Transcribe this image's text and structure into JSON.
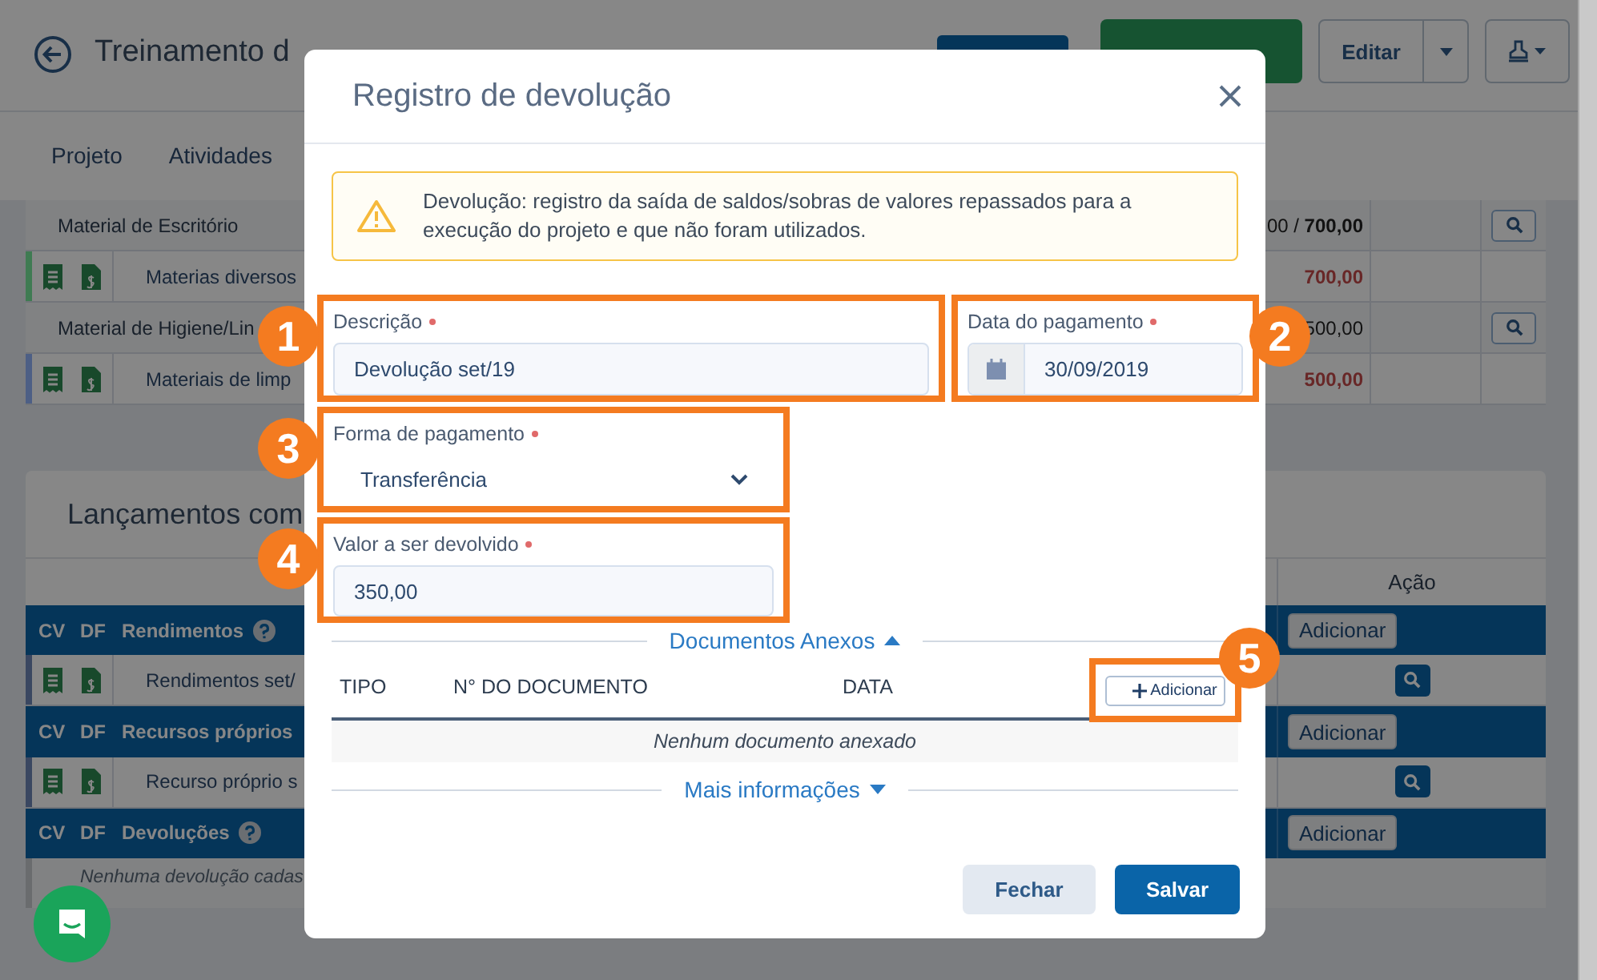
{
  "page": {
    "title": "Treinamento d",
    "edit_button": "Editar"
  },
  "tabs": [
    {
      "label": "Projeto",
      "selected": false
    },
    {
      "label": "Atividades",
      "selected": false
    }
  ],
  "budget_rows": [
    {
      "kind": "group",
      "label": "Material de Escritório",
      "value": "00 / **700,00**"
    },
    {
      "kind": "item",
      "label": "Materias diversos",
      "value": "700,00",
      "color": "#3f7b52"
    },
    {
      "kind": "group",
      "label": "Material de Higiene/Lin",
      "value": "500,00"
    },
    {
      "kind": "item",
      "label": "Materiais de limp",
      "value": "500,00",
      "color": "#4d5f85"
    }
  ],
  "entries": {
    "title": "Lançamentos com",
    "action_header": "Ação",
    "rows": [
      {
        "kind": "category",
        "cv": "CV",
        "df": "DF",
        "label": "Rendimentos",
        "help": true,
        "action": "Adicionar"
      },
      {
        "kind": "entry",
        "label": "Rendimentos set/"
      },
      {
        "kind": "category",
        "cv": "CV",
        "df": "DF",
        "label": "Recursos próprios",
        "help": false,
        "action": "Adicionar"
      },
      {
        "kind": "entry",
        "label": "Recurso próprio s"
      },
      {
        "kind": "category",
        "cv": "CV",
        "df": "DF",
        "label": "Devoluções",
        "help": true,
        "action": "Adicionar"
      },
      {
        "kind": "empty",
        "label": "Nenhuma devolução cadas"
      }
    ]
  },
  "modal": {
    "title": "Registro de devolução",
    "notice": "Devolução: registro da saída de saldos/sobras de valores repassados para a execução do projeto e que não foram utilizados.",
    "fields": [
      {
        "kind": "text",
        "label": "Descrição",
        "required": true,
        "value": "Devolução set/19",
        "callout": "1"
      },
      {
        "kind": "date",
        "label": "Data do pagamento",
        "required": true,
        "value": "30/09/2019",
        "callout": "2"
      },
      {
        "kind": "select",
        "label": "Forma de pagamento",
        "required": true,
        "value": "Transferência",
        "callout": "3"
      },
      {
        "kind": "text",
        "label": "Valor a ser devolvido",
        "required": true,
        "value": "350,00",
        "callout": "4"
      }
    ],
    "attachments": {
      "title": "Documentos Anexos",
      "expanded": true,
      "columns": [
        "TIPO",
        "N° DO DOCUMENTO",
        "DATA"
      ],
      "add_button": "Adicionar",
      "callout": "5",
      "empty": "Nenhum documento anexado"
    },
    "more_info": {
      "title": "Mais informações",
      "expanded": false
    },
    "buttons": [
      {
        "kind": "secondary",
        "label": "Fechar"
      },
      {
        "kind": "primary",
        "label": "Salvar"
      }
    ]
  }
}
